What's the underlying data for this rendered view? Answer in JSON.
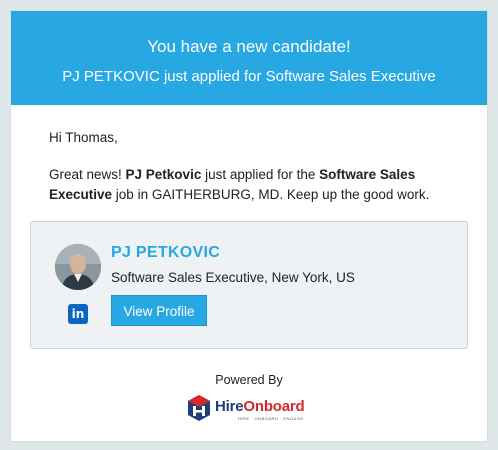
{
  "header": {
    "title": "You have a new candidate!",
    "subtitle": "PJ PETKOVIC just applied for Software Sales Executive"
  },
  "message": {
    "greeting": "Hi Thomas,",
    "intro": "Great news! ",
    "candidate_name": "PJ Petkovic",
    "mid": " just applied for the ",
    "job_title": "Software Sales Executive",
    "tail": " job in GAITHERBURG, MD. Keep up the good work."
  },
  "candidate": {
    "name": "PJ PETKOVIC",
    "role_location": "Software Sales Executive, New York, US",
    "view_profile_label": "View Profile",
    "linkedin_icon": "linkedin-icon"
  },
  "footer": {
    "powered_by": "Powered By",
    "logo_text_a": "Hire",
    "logo_text_b": "Onboard",
    "logo_tagline": "HIRE · ONBOARD · ENGAGE"
  },
  "colors": {
    "brand_blue": "#27a8e2",
    "logo_navy": "#1d3f7a",
    "logo_red": "#d42a2a",
    "linkedin": "#0a66c2"
  }
}
